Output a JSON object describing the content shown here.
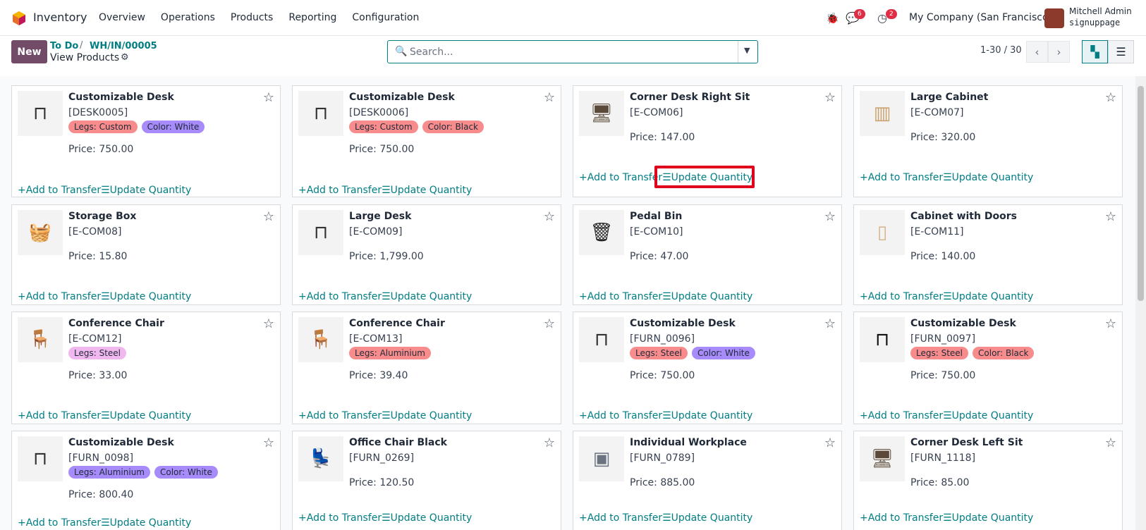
{
  "app": {
    "name": "Inventory"
  },
  "menu": [
    "Overview",
    "Operations",
    "Products",
    "Reporting",
    "Configuration"
  ],
  "header": {
    "messages_count": "6",
    "activities_count": "2",
    "company": "My Company (San Francisco)",
    "user_name": "Mitchell Admin",
    "db_name": "signuppage"
  },
  "control": {
    "new_label": "New",
    "breadcrumb": [
      "To Do",
      "WH/IN/00005"
    ],
    "breadcrumb_sep": "/",
    "subtitle": "View Products",
    "search_placeholder": "Search...",
    "pager": "1-30 / 30"
  },
  "actions": {
    "add": "Add to Transfer",
    "update": "Update Quantity"
  },
  "icons": {
    "logo": "odoo-logo",
    "bug": "bug-icon",
    "chat": "chat-icon",
    "clock": "clock-icon",
    "gear": "gear-icon",
    "search": "search-icon",
    "star": "star-icon",
    "plus": "plus-icon",
    "list": "list-icon"
  },
  "colors": {
    "accent": "#017e84",
    "brand": "#714b67",
    "badge": "#e02c45",
    "highlight": "#e0001b"
  },
  "products": [
    {
      "name": "Customizable Desk",
      "ref": "[DESK0005]",
      "tags": [
        {
          "text": "Legs: Custom",
          "color": "#f88c8c"
        },
        {
          "text": "Color: White",
          "color": "#a78bfa"
        }
      ],
      "price": "Price: 750.00",
      "img": "desk-white"
    },
    {
      "name": "Customizable Desk",
      "ref": "[DESK0006]",
      "tags": [
        {
          "text": "Legs: Custom",
          "color": "#f88c8c"
        },
        {
          "text": "Color: Black",
          "color": "#f88c8c"
        }
      ],
      "price": "Price: 750.00",
      "img": "desk-white"
    },
    {
      "name": "Corner Desk Right Sit",
      "ref": "[E-COM06]",
      "tags": [],
      "price": "Price: 147.00",
      "img": "corner-desk"
    },
    {
      "name": "Large Cabinet",
      "ref": "[E-COM07]",
      "tags": [],
      "price": "Price: 320.00",
      "img": "cabinet"
    },
    {
      "name": "Storage Box",
      "ref": "[E-COM08]",
      "tags": [],
      "price": "Price: 15.80",
      "img": "box"
    },
    {
      "name": "Large Desk",
      "ref": "[E-COM09]",
      "tags": [],
      "price": "Price: 1,799.00",
      "img": "large-desk"
    },
    {
      "name": "Pedal Bin",
      "ref": "[E-COM10]",
      "tags": [],
      "price": "Price: 47.00",
      "img": "bin"
    },
    {
      "name": "Cabinet with Doors",
      "ref": "[E-COM11]",
      "tags": [],
      "price": "Price: 140.00",
      "img": "cabinet-doors"
    },
    {
      "name": "Conference Chair",
      "ref": "[E-COM12]",
      "tags": [
        {
          "text": "Legs: Steel",
          "color": "#f0b8ef"
        }
      ],
      "price": "Price: 33.00",
      "img": "chair"
    },
    {
      "name": "Conference Chair",
      "ref": "[E-COM13]",
      "tags": [
        {
          "text": "Legs: Aluminium",
          "color": "#f88c8c"
        }
      ],
      "price": "Price: 39.40",
      "img": "chair"
    },
    {
      "name": "Customizable Desk",
      "ref": "[FURN_0096]",
      "tags": [
        {
          "text": "Legs: Steel",
          "color": "#f88c8c"
        },
        {
          "text": "Color: White",
          "color": "#a78bfa"
        }
      ],
      "price": "Price: 750.00",
      "img": "desk-white"
    },
    {
      "name": "Customizable Desk",
      "ref": "[FURN_0097]",
      "tags": [
        {
          "text": "Legs: Steel",
          "color": "#f88c8c"
        },
        {
          "text": "Color: Black",
          "color": "#f88c8c"
        }
      ],
      "price": "Price: 750.00",
      "img": "desk-black"
    },
    {
      "name": "Customizable Desk",
      "ref": "[FURN_0098]",
      "tags": [
        {
          "text": "Legs: Aluminium",
          "color": "#a78bfa"
        },
        {
          "text": "Color: White",
          "color": "#a78bfa"
        }
      ],
      "price": "Price: 800.40",
      "img": "desk-white"
    },
    {
      "name": "Office Chair Black",
      "ref": "[FURN_0269]",
      "tags": [],
      "price": "Price: 120.50",
      "img": "office-chair"
    },
    {
      "name": "Individual Workplace",
      "ref": "[FURN_0789]",
      "tags": [],
      "price": "Price: 885.00",
      "img": "workplace"
    },
    {
      "name": "Corner Desk Left Sit",
      "ref": "[FURN_1118]",
      "tags": [],
      "price": "Price: 85.00",
      "img": "corner-desk"
    }
  ]
}
